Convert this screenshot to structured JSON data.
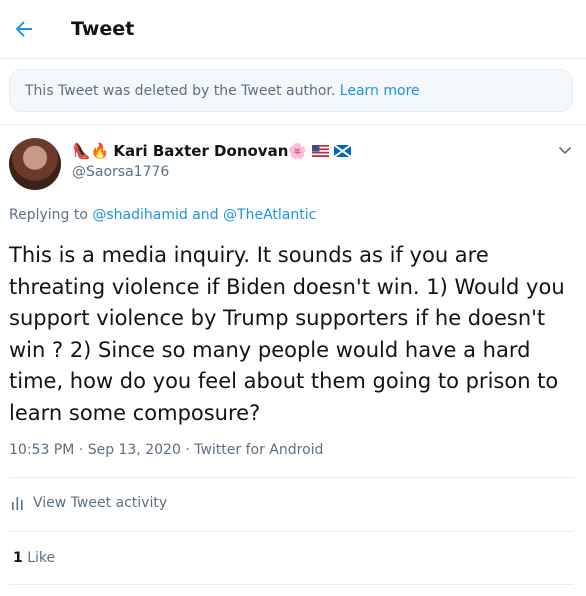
{
  "header": {
    "title": "Tweet",
    "back_icon": "arrow-left-icon"
  },
  "notice": {
    "text": "This Tweet was deleted by the Tweet author.",
    "link": "Learn more"
  },
  "author": {
    "emoji_prefix": "👠🔥",
    "name": "Kari Baxter Donovan",
    "emoji_suffix": "🌸",
    "handle": "@Saorsa1776"
  },
  "replying": {
    "prefix": "Replying to ",
    "user1": "@shadihamid",
    "joiner": " and ",
    "user2": "@TheAtlantic"
  },
  "tweet_text": "This is a media inquiry. It sounds as if you are threating violence if Biden doesn't win. 1) Would you support violence by Trump supporters if he doesn't win ? 2) Since so many people would have a hard time, how do you feel about them going to prison to learn some composure?",
  "meta": {
    "time": "10:53 PM",
    "sep1": " · ",
    "date": "Sep 13, 2020",
    "sep2": " · ",
    "client": "Twitter for Android"
  },
  "activity": {
    "label": "View Tweet activity"
  },
  "likes": {
    "count": "1",
    "label": "Like"
  },
  "colors": {
    "accent": "#1b95e0",
    "secondary_text": "#5b7083",
    "border": "#e6ecf0"
  }
}
